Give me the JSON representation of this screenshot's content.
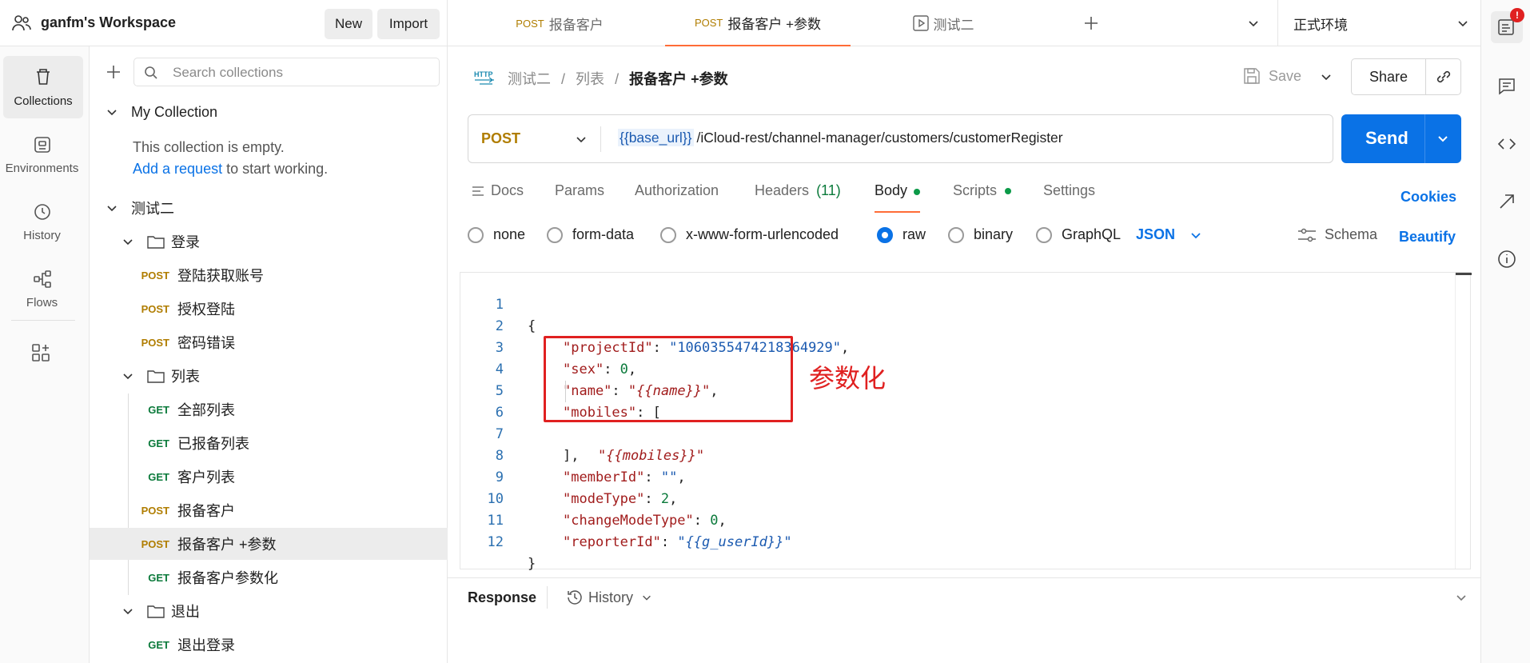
{
  "workspace": {
    "name": "ganfm's Workspace",
    "new_label": "New",
    "import_label": "Import"
  },
  "rail": [
    {
      "label": "Collections",
      "icon": "trash-bin-icon"
    },
    {
      "label": "Environments",
      "icon": "environment-icon"
    },
    {
      "label": "History",
      "icon": "history-icon"
    },
    {
      "label": "Flows",
      "icon": "flows-icon"
    }
  ],
  "sidebar": {
    "search_placeholder": "Search collections",
    "my_collection": "My Collection",
    "empty_text": "This collection is empty.",
    "add_request_link": "Add a request",
    "add_request_suffix": " to start working.",
    "collection2": "测试二",
    "folder_login": "登录",
    "folder_list": "列表",
    "folder_logout": "退出",
    "requests": [
      {
        "method": "POST",
        "name": "登陆获取账号"
      },
      {
        "method": "POST",
        "name": "授权登陆"
      },
      {
        "method": "POST",
        "name": "密码错误"
      },
      {
        "method": "GET",
        "name": "全部列表"
      },
      {
        "method": "GET",
        "name": "已报备列表"
      },
      {
        "method": "GET",
        "name": "客户列表"
      },
      {
        "method": "POST",
        "name": "报备客户"
      },
      {
        "method": "POST",
        "name": "报备客户 +参数"
      },
      {
        "method": "GET",
        "name": "报备客户参数化"
      },
      {
        "method": "GET",
        "name": "退出登录"
      }
    ]
  },
  "tabs": [
    {
      "method": "POST",
      "name": "报备客户"
    },
    {
      "method": "POST",
      "name": "报备客户 +参数"
    },
    {
      "method": "",
      "name": "测试二"
    }
  ],
  "environment": "正式环境",
  "breadcrumb": {
    "method_badge": "HTTP",
    "p1": "测试二",
    "sep": "/",
    "p2": "列表",
    "current": "报备客户 +参数"
  },
  "toolbar": {
    "save_label": "Save",
    "share_label": "Share"
  },
  "request": {
    "method": "POST",
    "url_var": "{{base_url}}",
    "url_path": "/iCloud-rest/channel-manager/customers/customerRegister",
    "send_label": "Send"
  },
  "req_tabs": {
    "docs": "Docs",
    "params": "Params",
    "authorization": "Authorization",
    "headers": "Headers",
    "headers_count": "(11)",
    "body": "Body",
    "scripts": "Scripts",
    "settings": "Settings",
    "cookies": "Cookies"
  },
  "body_types": {
    "none": "none",
    "form_data": "form-data",
    "urlencoded": "x-www-form-urlencoded",
    "raw": "raw",
    "binary": "binary",
    "graphql": "GraphQL",
    "json": "JSON",
    "schema": "Schema",
    "beautify": "Beautify"
  },
  "code": {
    "line_numbers": [
      "1",
      "2",
      "3",
      "4",
      "5",
      "6",
      "7",
      "8",
      "9",
      "10",
      "11",
      "12"
    ],
    "open_brace": "{",
    "close_brace": "}",
    "k_projectId": "\"projectId\"",
    "v_projectId": "\"1060355474218364929\"",
    "k_sex": "\"sex\"",
    "v_sex": "0",
    "k_name": "\"name\"",
    "v_name": "{{name}}",
    "k_mobiles": "\"mobiles\"",
    "open_bracket": "[",
    "v_mobiles": "{{mobiles}}",
    "close_bracket": "],",
    "k_memberId": "\"memberId\"",
    "v_memberId": "\"\"",
    "k_modeType": "\"modeType\"",
    "v_modeType": "2",
    "k_changeModeType": "\"changeModeType\"",
    "v_changeModeType": "0",
    "k_reporterId": "\"reporterId\"",
    "v_reporterId": "{{g_userId}}"
  },
  "annotation": "参数化",
  "response": {
    "label": "Response",
    "history_label": "History"
  },
  "colors": {
    "accent": "#0a72e6",
    "post": "#b07d00",
    "get": "#0b7a3b",
    "annotation": "#e02020"
  }
}
